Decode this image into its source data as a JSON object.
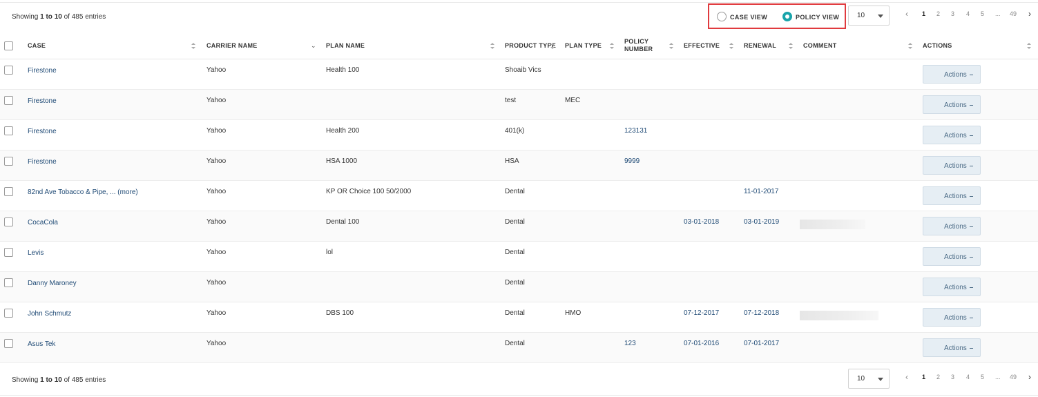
{
  "info": {
    "prefix": "Showing",
    "range": "1 to 10",
    "suffix": "of 485 entries"
  },
  "view_toggle": {
    "case_view_label": "CASE VIEW",
    "policy_view_label": "POLICY VIEW",
    "selected": "policy"
  },
  "page_size": {
    "value": "10"
  },
  "pagination": {
    "prev_icon": "chevron-left-icon",
    "pages": [
      "1",
      "2",
      "3",
      "4",
      "5",
      "...",
      "49"
    ],
    "active": "1",
    "next_icon": "chevron-right-icon"
  },
  "table": {
    "columns": [
      "CASE",
      "CARRIER NAME",
      "PLAN NAME",
      "PRODUCT TYPE",
      "PLAN TYPE",
      "POLICY NUMBER",
      "EFFECTIVE",
      "RENEWAL",
      "COMMENT",
      "ACTIONS"
    ],
    "actions_label": "Actions",
    "rows": [
      {
        "case": "Firestone",
        "carrier": "Yahoo",
        "plan": "Health 100",
        "product": "Shoaib Vics",
        "plan_type": "",
        "policy": "",
        "effective": "",
        "renewal": "",
        "comment_blurred": false
      },
      {
        "case": "Firestone",
        "carrier": "Yahoo",
        "plan": "",
        "product": "test",
        "plan_type": "MEC",
        "policy": "",
        "effective": "",
        "renewal": "",
        "comment_blurred": false
      },
      {
        "case": "Firestone",
        "carrier": "Yahoo",
        "plan": "Health 200",
        "product": "401(k)",
        "plan_type": "",
        "policy": "123131",
        "effective": "",
        "renewal": "",
        "comment_blurred": false
      },
      {
        "case": "Firestone",
        "carrier": "Yahoo",
        "plan": "HSA 1000",
        "product": "HSA",
        "plan_type": "",
        "policy": "9999",
        "effective": "",
        "renewal": "",
        "comment_blurred": false
      },
      {
        "case": "82nd Ave Tobacco & Pipe, ... (more)",
        "carrier": "Yahoo",
        "plan": "KP OR Choice 100 50/2000",
        "product": "Dental",
        "plan_type": "",
        "policy": "",
        "effective": "",
        "renewal": "11-01-2017",
        "comment_blurred": false
      },
      {
        "case": "CocaCola",
        "carrier": "Yahoo",
        "plan": "Dental 100",
        "product": "Dental",
        "plan_type": "",
        "policy": "",
        "effective": "03-01-2018",
        "renewal": "03-01-2019",
        "comment_blurred": true
      },
      {
        "case": "Levis",
        "carrier": "Yahoo",
        "plan": "lol",
        "product": "Dental",
        "plan_type": "",
        "policy": "",
        "effective": "",
        "renewal": "",
        "comment_blurred": false
      },
      {
        "case": "Danny Maroney",
        "carrier": "Yahoo",
        "plan": "",
        "product": "Dental",
        "plan_type": "",
        "policy": "",
        "effective": "",
        "renewal": "",
        "comment_blurred": false
      },
      {
        "case": "John Schmutz",
        "carrier": "Yahoo",
        "plan": "DBS 100",
        "product": "Dental",
        "plan_type": "HMO",
        "policy": "",
        "effective": "07-12-2017",
        "renewal": "07-12-2018",
        "comment_blurred": true
      },
      {
        "case": "Asus Tek",
        "carrier": "Yahoo",
        "plan": "",
        "product": "Dental",
        "plan_type": "",
        "policy": "123",
        "effective": "07-01-2016",
        "renewal": "07-01-2017",
        "comment_blurred": false
      }
    ]
  }
}
